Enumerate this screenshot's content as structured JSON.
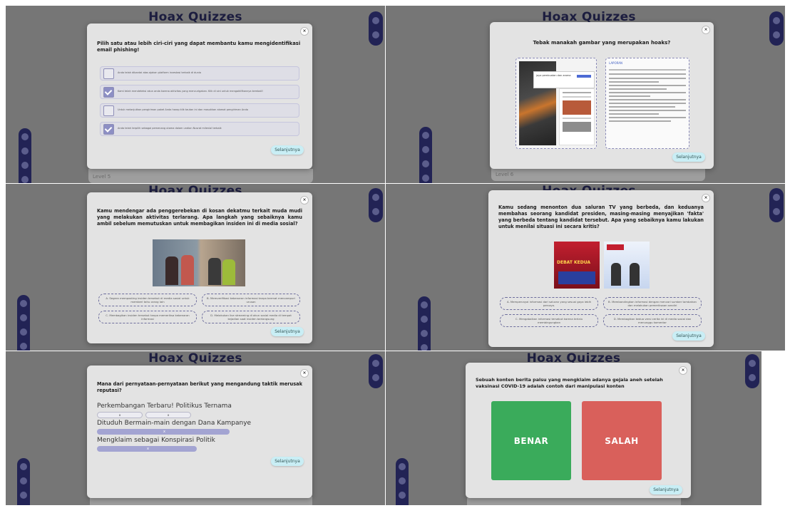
{
  "app_title": "Hoax Quizzes",
  "next_label": "Selanjutnya",
  "close_glyph": "×",
  "colors": {
    "modal": "#e3e3e3",
    "next": "#c9eef5",
    "option_bar": "#a3a4d2",
    "benar": "#3aab5b",
    "salah": "#d9605b",
    "pill": "#222355"
  },
  "icons": [
    "home-icon",
    "car-icon",
    "list-icon",
    "star-icon",
    "person-icon",
    "settings-icon"
  ],
  "panel1": {
    "question": "Pilih satu atau lebih ciri-ciri yang dapat membantu kamu mengidentifikasi email phishing!",
    "items": [
      {
        "text": "Anda telah dibantai atas ajakan platform investasi terbaik di dunia",
        "checked": false
      },
      {
        "text": "Kami telah mendeteksi akun anda karena aktivitas yang mencurigakan. Klik di sini untuk mengaktifkannya kembali!",
        "checked": true
      },
      {
        "text": "Untuk melanjutkan pengiriman paket Anda harap klik tautan ini dan masukkan alamat pengiriman Anda",
        "checked": false
      },
      {
        "text": "Anda telah terpilih sebagai pemenang utama dalam undian Nusrat milenial terbaik",
        "checked": true
      }
    ],
    "level": "Level 5"
  },
  "panel2": {
    "question": "Tebak manakah gambar yang merupakan hoaks?",
    "left_caption": "jaya pembuatan dan aroma",
    "right_header": "LAPORAN",
    "level": "Level 6"
  },
  "panel3": {
    "question": "Kamu mendengar ada penggerebekan di kosan dekatmu terkait muda mudi yang melakukan aktivitas terlarang. Apa langkah yang sebaiknya kamu ambil sebelum memutuskan untuk membagikan insiden ini di media sosial?",
    "options": [
      "A. Segera memposting insiden tersebut di media sosial untuk memberi tahu orang lain",
      "B. Memverifikasi kebenaran informasi tanpa bermat mencampuri urusan",
      "C. Membagikan insiden tersebut tanpa memeriksa kebenaran informasi",
      "D. Melakukan live streaming di akun sosial media di tempat kejadian saat insiden berlangsung"
    ]
  },
  "panel4": {
    "question": "Kamu sedang menonton dua saluran TV yang berbeda, dan keduanya membahas seorang kandidat presiden, masing-masing menyajikan 'fakta' yang berbeda tentang kandidat tersebut. Apa yang sebaiknya kamu lakukan untuk menilai situasi ini secara kritis?",
    "image_text": "DEBAT KEDUA",
    "options": [
      "A. Mempercayai informasi dari saluran yang sesuai gaya lebih percaya.",
      "B. Membandingkan informasi dengan mencari sumber tambahan dan melakukan pemeriksaan sendiri",
      "C. Mengabaikan informasi tersebut karena terlalu membingungkan",
      "D. Membagikan kedua versi cerita ini di media sosial dan menunggu komentar"
    ]
  },
  "panel5": {
    "question": "Mana dari pernyataan-pernyataan berikut yang mengandung taktik merusak reputasi?",
    "phrase1": "Perkembangan Terbaru! Politikus Ternama",
    "phrase2": "Dituduh Bermain-main dengan Dana Kampanye",
    "phrase3": "Mengklaim sebagai Konspirasi Politik",
    "mark": "x"
  },
  "panel6": {
    "question": "Sebuah konten berita palsu yang mengklaim adanya gejala aneh setelah vaksinasi COVID-19 adalah contoh dari manipulasi konten",
    "true_label": "BENAR",
    "false_label": "SALAH"
  }
}
